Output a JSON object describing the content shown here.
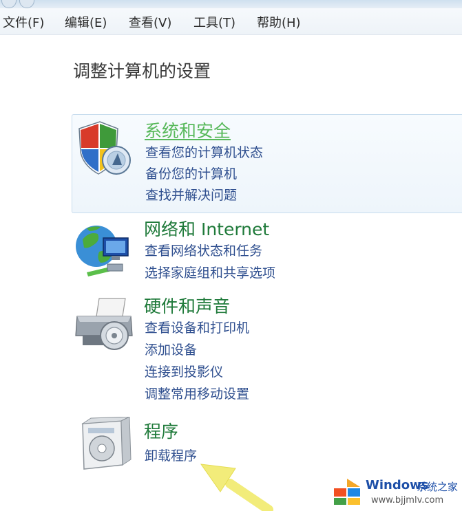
{
  "menubar": {
    "items": [
      "文件(F)",
      "编辑(E)",
      "查看(V)",
      "工具(T)",
      "帮助(H)"
    ]
  },
  "page_title": "调整计算机的设置",
  "categories": [
    {
      "title": "系统和安全",
      "icon": "shield-icon",
      "links": [
        "查看您的计算机状态",
        "备份您的计算机",
        "查找并解决问题"
      ]
    },
    {
      "title": "网络和 Internet",
      "icon": "network-globe-icon",
      "links": [
        "查看网络状态和任务",
        "选择家庭组和共享选项"
      ]
    },
    {
      "title": "硬件和声音",
      "icon": "printer-icon",
      "links": [
        "查看设备和打印机",
        "添加设备",
        "连接到投影仪",
        "调整常用移动设置"
      ]
    },
    {
      "title": "程序",
      "icon": "programs-box-icon",
      "links": [
        "卸载程序"
      ]
    }
  ],
  "watermark": {
    "brand": "Windows",
    "brand_cn": "系统之家",
    "url": "www.bjjmlv.com"
  },
  "colors": {
    "accent_green": "#57b85a",
    "category_green": "#1f7a3a",
    "link_blue": "#2f4f8f",
    "arrow_yellow": "#f2ec7a"
  }
}
